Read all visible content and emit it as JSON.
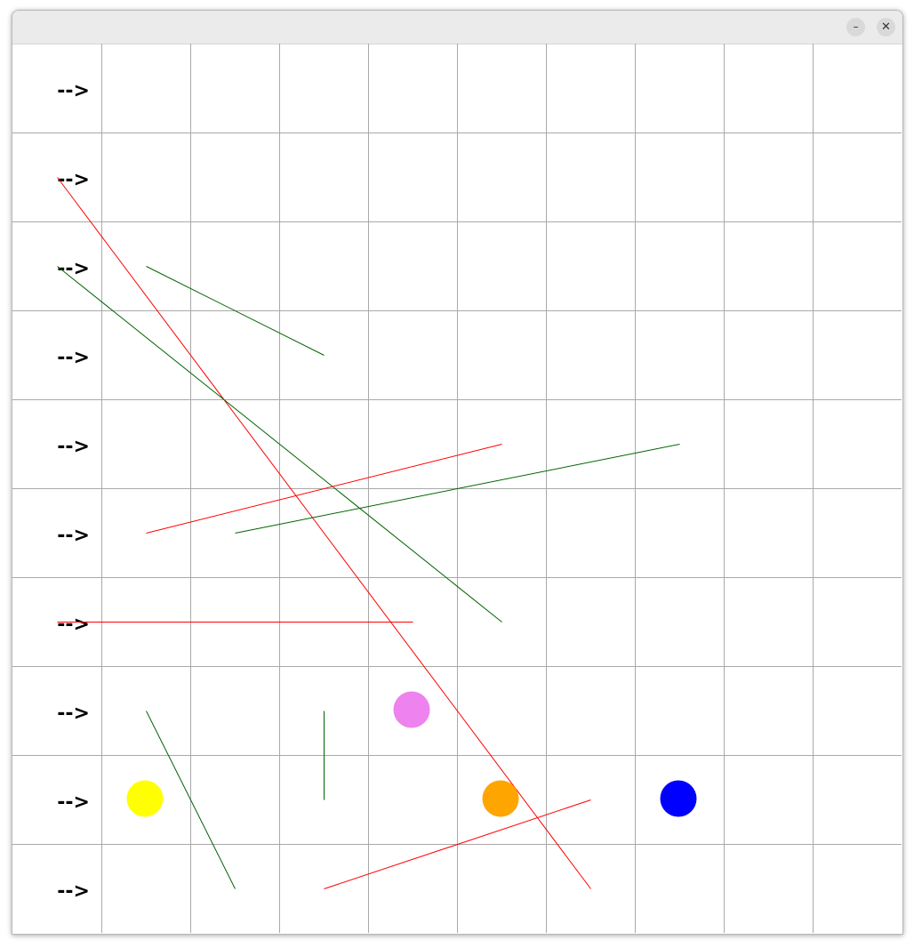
{
  "window": {
    "minimize_glyph": "–",
    "close_glyph": "✕"
  },
  "grid": {
    "rows": 10,
    "cols": 10,
    "line_color": "#a9a9a9",
    "row_labels": [
      "-->",
      "-->",
      "-->",
      "-->",
      "-->",
      "-->",
      "-->",
      "-->",
      "-->",
      "-->"
    ]
  },
  "lines": [
    {
      "from": [
        0.5,
        1.5
      ],
      "to": [
        6.5,
        9.5
      ],
      "color": "#ff0000"
    },
    {
      "from": [
        0.5,
        2.5
      ],
      "to": [
        5.5,
        6.5
      ],
      "color": "#006400"
    },
    {
      "from": [
        1.5,
        2.5
      ],
      "to": [
        3.5,
        3.5
      ],
      "color": "#006400"
    },
    {
      "from": [
        1.5,
        5.5
      ],
      "to": [
        5.5,
        4.5
      ],
      "color": "#ff0000"
    },
    {
      "from": [
        2.5,
        5.5
      ],
      "to": [
        7.5,
        4.5
      ],
      "color": "#006400"
    },
    {
      "from": [
        0.5,
        6.5
      ],
      "to": [
        4.5,
        6.5
      ],
      "color": "#ff0000"
    },
    {
      "from": [
        1.5,
        7.5
      ],
      "to": [
        2.5,
        9.5
      ],
      "color": "#006400"
    },
    {
      "from": [
        3.5,
        7.5
      ],
      "to": [
        3.5,
        8.5
      ],
      "color": "#006400"
    },
    {
      "from": [
        3.5,
        9.5
      ],
      "to": [
        6.5,
        8.5
      ],
      "color": "#ff0000"
    }
  ],
  "circles": [
    {
      "cell": [
        4.5,
        7.5
      ],
      "color": "#ee82ee",
      "name": "violet"
    },
    {
      "cell": [
        1.5,
        8.5
      ],
      "color": "#ffff00",
      "name": "yellow"
    },
    {
      "cell": [
        5.5,
        8.5
      ],
      "color": "#ffa500",
      "name": "orange"
    },
    {
      "cell": [
        7.5,
        8.5
      ],
      "color": "#0000ff",
      "name": "blue"
    }
  ]
}
